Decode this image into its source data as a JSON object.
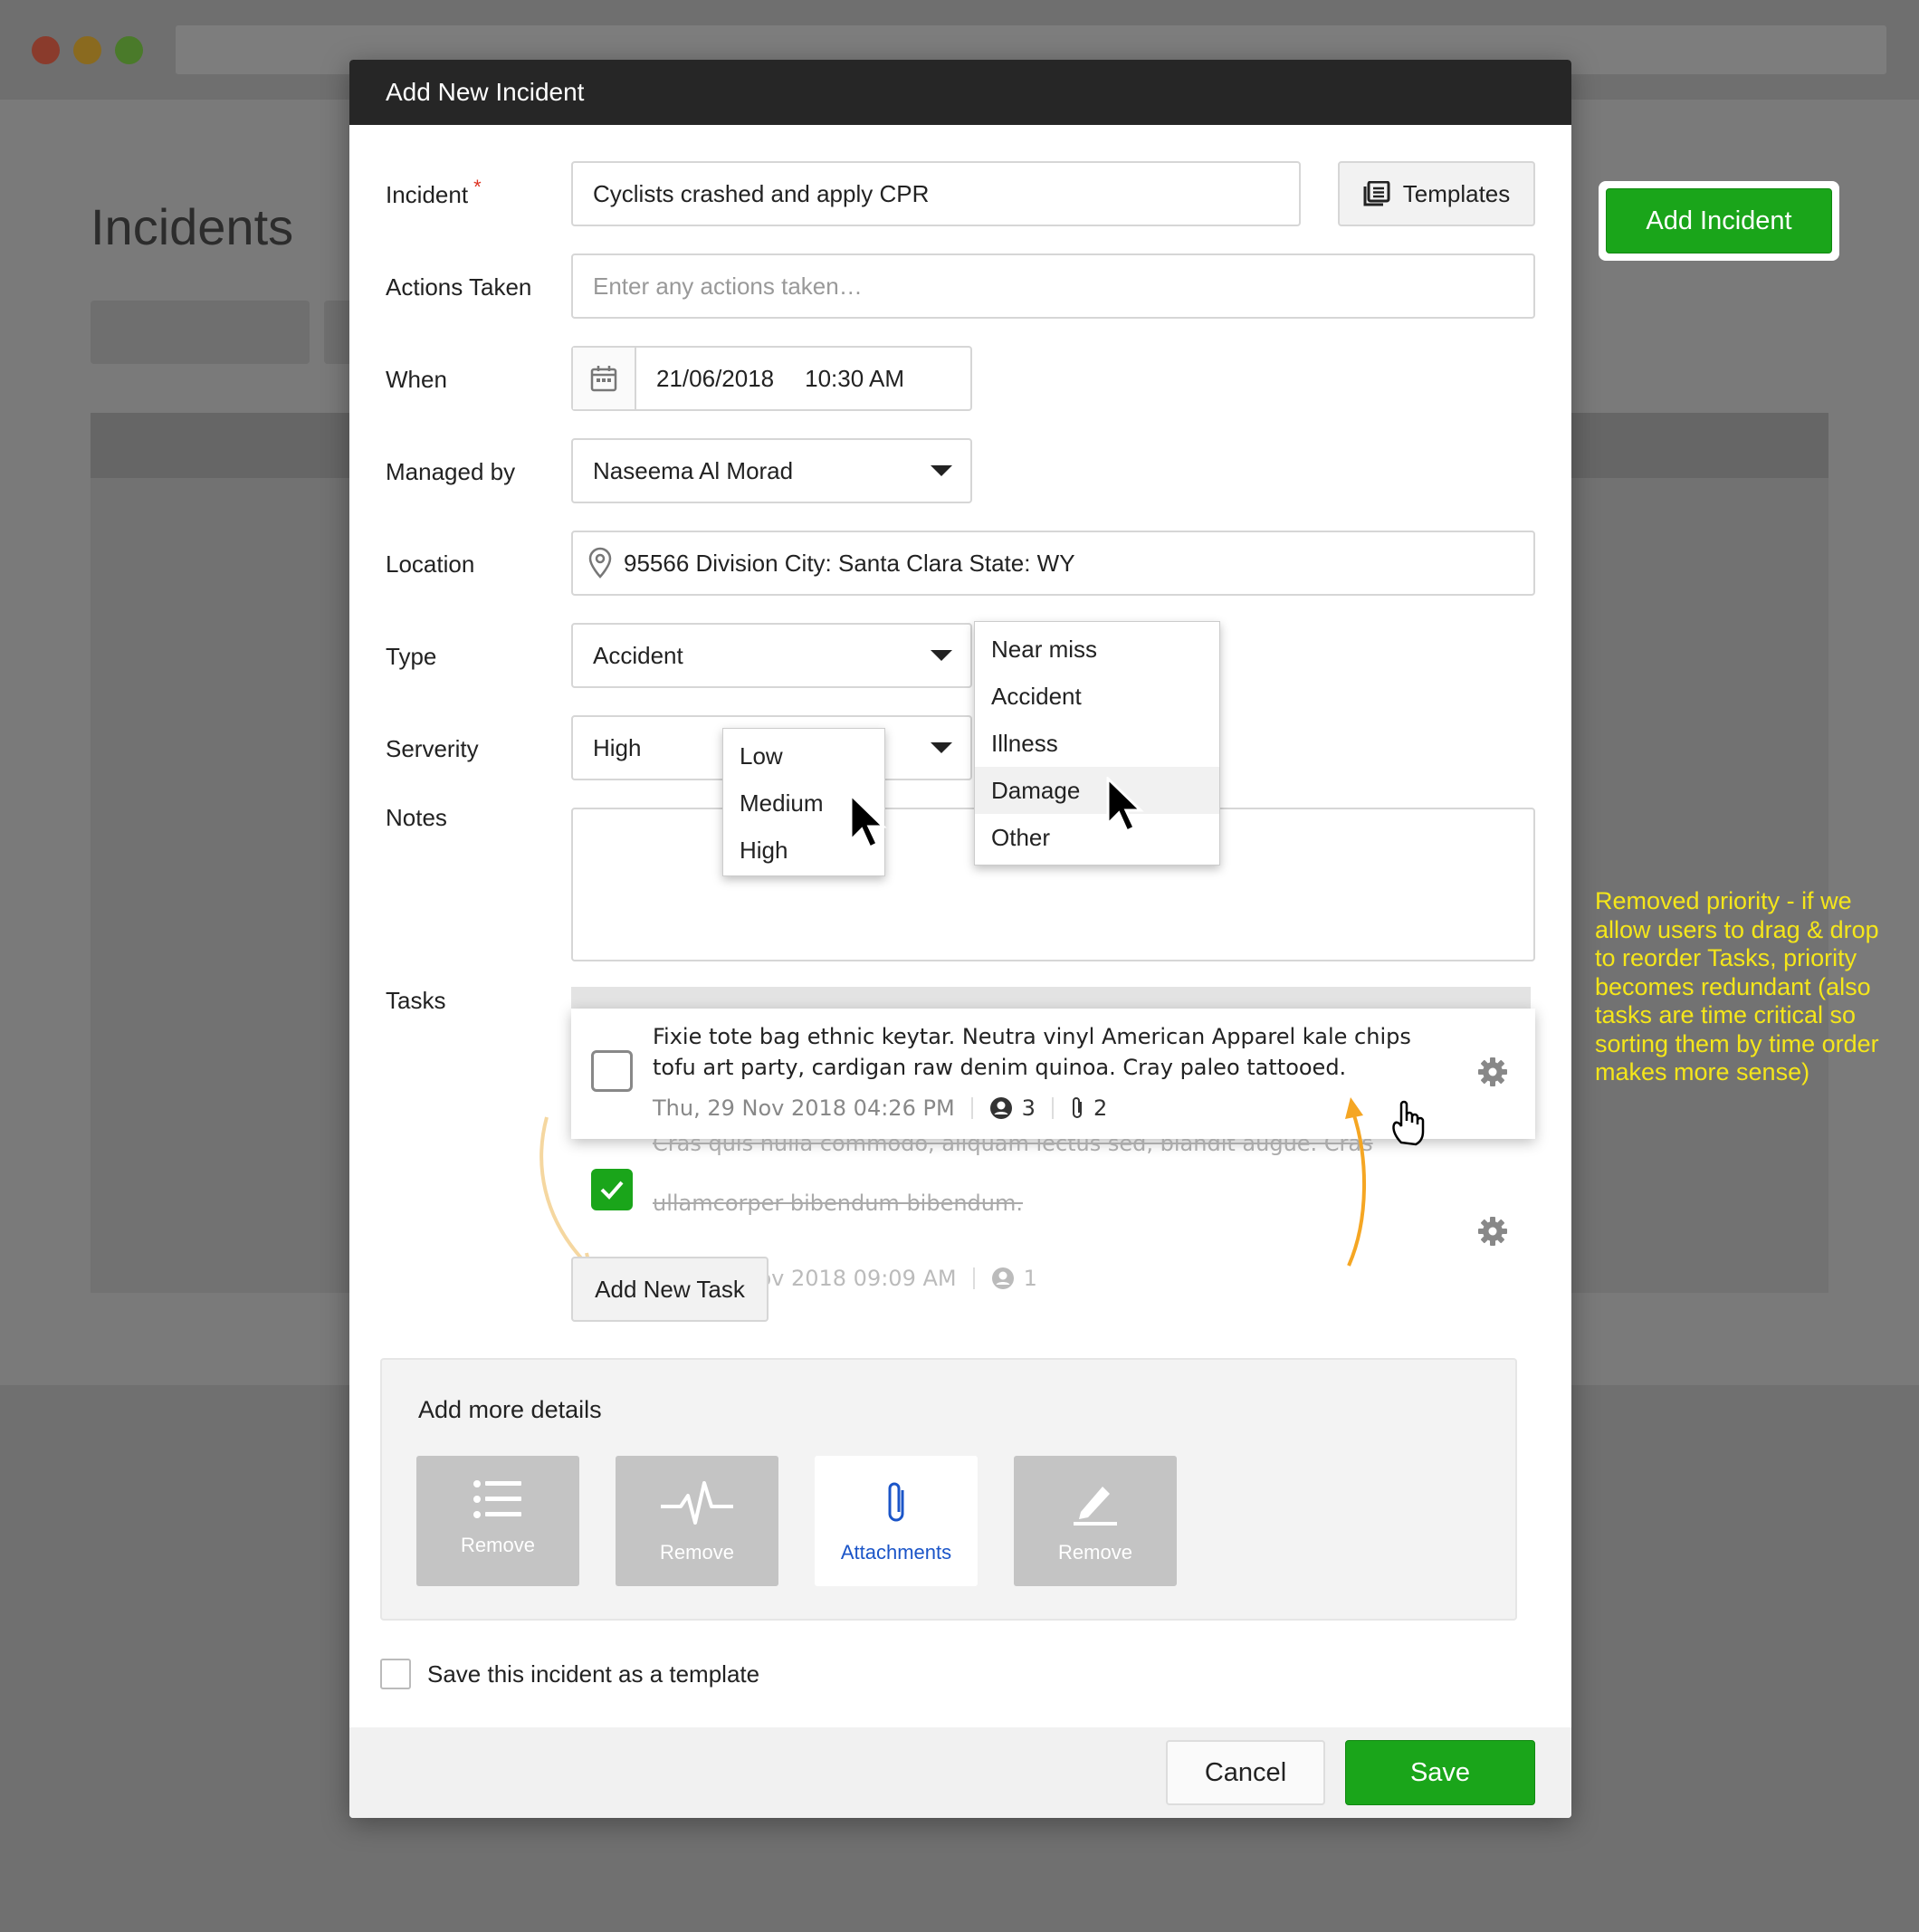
{
  "background": {
    "page_title": "Incidents",
    "add_incident_label": "Add Incident"
  },
  "annotation": {
    "text": "Removed priority - if we allow users to drag & drop to reorder Tasks, priority becomes redundant (also tasks are time critical so sorting them by time order makes more sense)",
    "color": "#f5e61a"
  },
  "modal": {
    "title": "Add New Incident",
    "fields": {
      "incident_label": "Incident",
      "incident_required": "*",
      "incident_value": "Cyclists crashed and apply CPR",
      "templates_label": "Templates",
      "actions_label": "Actions Taken",
      "actions_placeholder": "Enter any actions taken…",
      "when_label": "When",
      "when_date": "21/06/2018",
      "when_time": "10:30 AM",
      "managed_label": "Managed by",
      "managed_value": "Naseema Al Morad",
      "location_label": "Location",
      "location_value": "95566 Division City: Santa Clara State: WY",
      "type_label": "Type",
      "type_value": "Accident",
      "severity_label": "Serverity",
      "severity_value": "High",
      "notes_label": "Notes",
      "tasks_label": "Tasks"
    },
    "severity_options": [
      "Low",
      "Medium",
      "High"
    ],
    "type_options": [
      "Near miss",
      "Accident",
      "Illness",
      "Damage",
      "Other"
    ],
    "tasks": [
      {
        "line1": "Fixie tote bag ethnic keytar. Neutra vinyl American Apparel kale chips",
        "line2": "tofu art party, cardigan raw denim quinoa. Cray paleo tattooed.",
        "date": "Thu, 29 Nov 2018 04:26 PM",
        "people": "3",
        "attachments": "2",
        "done": false
      },
      {
        "line1": "Cras quis nulla commodo, aliquam lectus sed, blandit augue. Cras",
        "line2": "ullamcorper bibendum bibendum.",
        "date": "Thu, 29 Nov 2018 09:09 AM",
        "people": "1",
        "done": true
      }
    ],
    "add_task_label": "Add New Task",
    "details": {
      "title": "Add more details",
      "tiles": [
        {
          "icon": "list-icon",
          "label": "Remove"
        },
        {
          "icon": "pulse-icon",
          "label": "Remove"
        },
        {
          "icon": "paperclip-icon",
          "label": "Attachments"
        },
        {
          "icon": "pencil-icon",
          "label": "Remove"
        }
      ]
    },
    "save_template_label": "Save this incident as a template",
    "cancel_label": "Cancel",
    "save_label": "Save"
  },
  "colors": {
    "accent_green": "#1aa51a",
    "header_dark": "#262626",
    "link_blue": "#1b55c8",
    "arrow_orange": "#f5a623"
  }
}
